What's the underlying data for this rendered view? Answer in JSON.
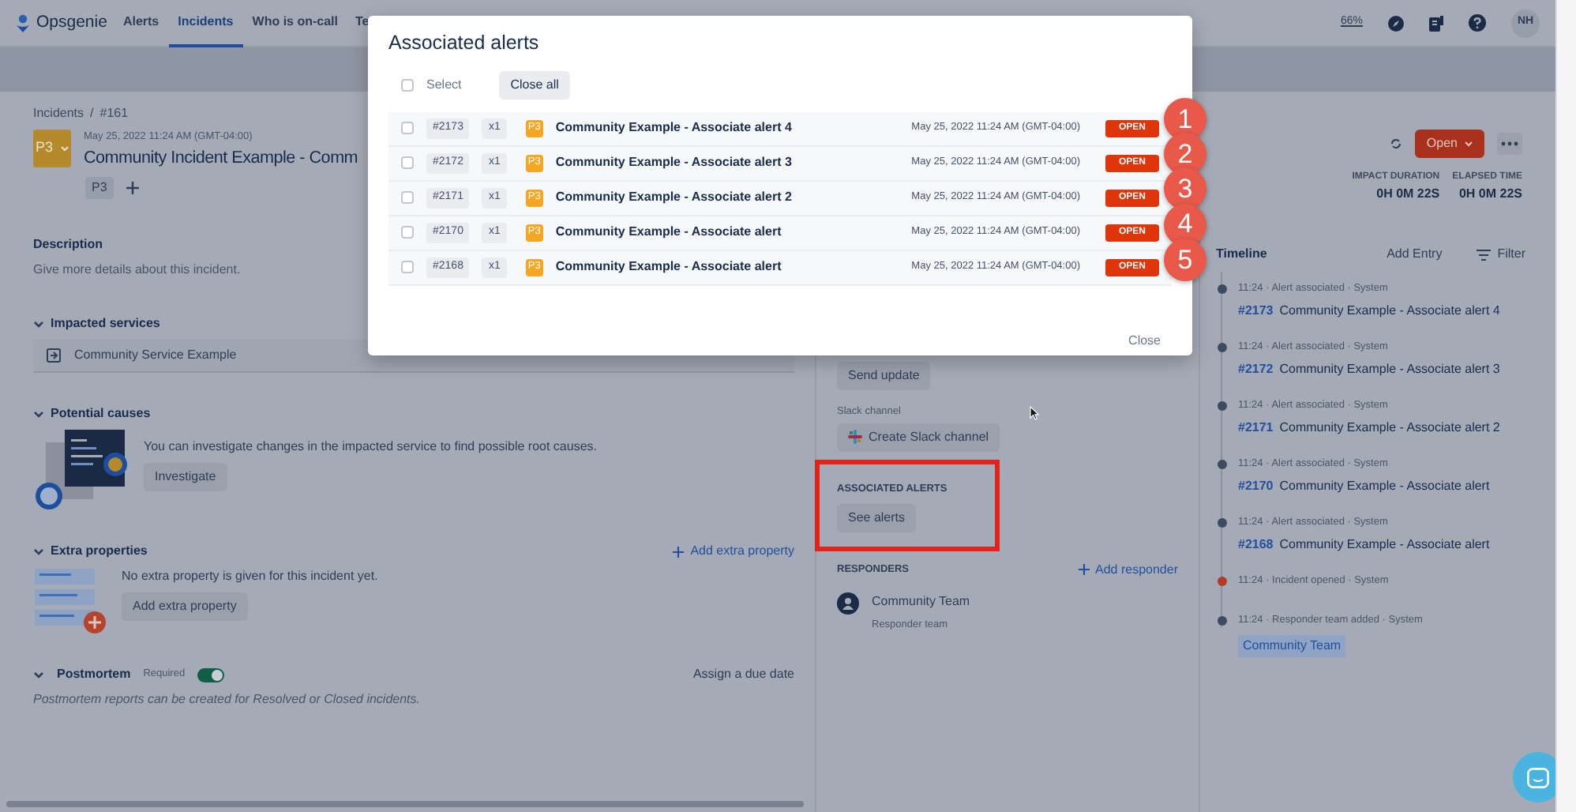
{
  "nav": {
    "logo": "Opsgenie",
    "items": [
      {
        "label": "Alerts",
        "selected": false
      },
      {
        "label": "Incidents",
        "selected": true
      },
      {
        "label": "Who is on-call",
        "selected": false
      },
      {
        "label": "Te",
        "selected": false
      }
    ],
    "zoom": "66%",
    "avatar": "NH"
  },
  "incident": {
    "breadcrumb": [
      "Incidents",
      "/",
      "#161"
    ],
    "priority": "P3",
    "date": "May 25, 2022 11:24 AM (GMT-04:00)",
    "title": "Community Incident Example - Comm",
    "tag": "P3",
    "status": "Open",
    "metrics": [
      {
        "label": "IMPACT DURATION",
        "value": "0H 0M 22S"
      },
      {
        "label": "ELAPSED TIME",
        "value": "0H 0M 22S"
      }
    ]
  },
  "sections": {
    "description": {
      "title": "Description",
      "text": "Give more details about this incident."
    },
    "impacted_services": {
      "title": "Impacted services",
      "expanded": true,
      "service": "Community Service Example"
    },
    "potential_causes": {
      "title": "Potential causes",
      "expanded": true,
      "text": "You can investigate changes in the impacted service to find possible root causes.",
      "button": "Investigate"
    },
    "extra_properties": {
      "title": "Extra properties",
      "expanded": true,
      "link": "Add extra property",
      "text": "No extra property is given for this incident yet.",
      "button": "Add extra property"
    },
    "postmortem": {
      "title": "Postmortem",
      "expanded": true,
      "required": "Required",
      "on": true,
      "link": "Assign a due date",
      "note": "Postmortem reports can be created for Resolved or Closed incidents."
    }
  },
  "side": {
    "send_update": "Send update",
    "slack": {
      "label": "Slack channel",
      "button": "Create Slack channel"
    },
    "associated_alerts": {
      "title": "ASSOCIATED ALERTS",
      "button": "See alerts"
    },
    "responders": {
      "title": "RESPONDERS",
      "link": "Add responder",
      "name": "Community Team",
      "role": "Responder team"
    }
  },
  "timeline": {
    "title": "Timeline",
    "add_entry": "Add Entry",
    "filter": "Filter",
    "entries": [
      {
        "kind": "alert",
        "color": "#3d4a5f",
        "meta": "11:24 · Alert associated · System",
        "ref": "#2173",
        "text": "Community Example - Associate alert 4"
      },
      {
        "kind": "alert",
        "color": "#3d4a5f",
        "meta": "11:24 · Alert associated · System",
        "ref": "#2172",
        "text": "Community Example - Associate alert 3"
      },
      {
        "kind": "alert",
        "color": "#3d4a5f",
        "meta": "11:24 · Alert associated · System",
        "ref": "#2171",
        "text": "Community Example - Associate alert 2"
      },
      {
        "kind": "alert",
        "color": "#3d4a5f",
        "meta": "11:24 · Alert associated · System",
        "ref": "#2170",
        "text": "Community Example - Associate alert"
      },
      {
        "kind": "alert",
        "color": "#3d4a5f",
        "meta": "11:24 · Alert associated · System",
        "ref": "#2168",
        "text": "Community Example - Associate alert"
      },
      {
        "kind": "plain",
        "color": "#b23a2a",
        "meta": "11:24 · Incident opened · System"
      },
      {
        "kind": "team",
        "color": "#3d4a5f",
        "meta": "11:24 · Responder team added · System",
        "text": "Community Team"
      }
    ]
  },
  "modal": {
    "title": "Associated alerts",
    "select": {
      "label": "Select",
      "checked": false
    },
    "close_all": "Close all",
    "alerts": [
      {
        "checked": false,
        "id": "#2173",
        "count": "x1",
        "priority": "P3",
        "title": "Community Example - Associate alert 4",
        "date": "May 25, 2022 11:24 AM (GMT-04:00)",
        "status": "OPEN"
      },
      {
        "checked": false,
        "id": "#2172",
        "count": "x1",
        "priority": "P3",
        "title": "Community Example - Associate alert 3",
        "date": "May 25, 2022 11:24 AM (GMT-04:00)",
        "status": "OPEN"
      },
      {
        "checked": false,
        "id": "#2171",
        "count": "x1",
        "priority": "P3",
        "title": "Community Example - Associate alert 2",
        "date": "May 25, 2022 11:24 AM (GMT-04:00)",
        "status": "OPEN"
      },
      {
        "checked": false,
        "id": "#2170",
        "count": "x1",
        "priority": "P3",
        "title": "Community Example - Associate alert",
        "date": "May 25, 2022 11:24 AM (GMT-04:00)",
        "status": "OPEN"
      },
      {
        "checked": false,
        "id": "#2168",
        "count": "x1",
        "priority": "P3",
        "title": "Community Example - Associate alert",
        "date": "May 25, 2022 11:24 AM (GMT-04:00)",
        "status": "OPEN"
      }
    ],
    "close": "Close"
  },
  "callouts": [
    "1",
    "2",
    "3",
    "4",
    "5"
  ]
}
